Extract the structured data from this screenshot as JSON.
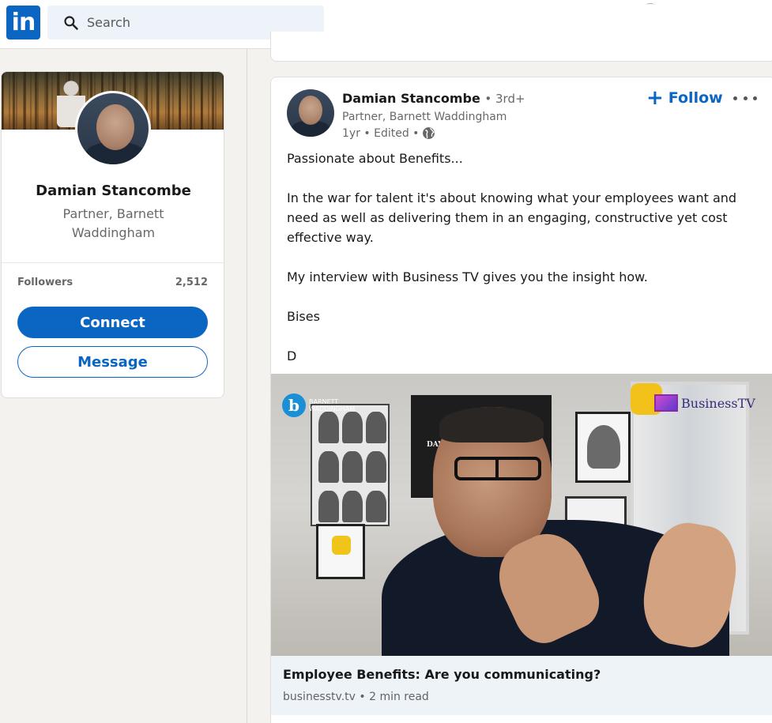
{
  "nav": {
    "logo_text": "in",
    "search_placeholder": "Search"
  },
  "profile_card": {
    "name": "Damian Stancombe",
    "title": "Partner, Barnett Waddingham",
    "followers_label": "Followers",
    "followers_count": "2,512",
    "connect_label": "Connect",
    "message_label": "Message"
  },
  "post": {
    "author": "Damian Stancombe",
    "degree": "• 3rd+",
    "headline": "Partner, Barnett Waddingham",
    "meta": "1yr • Edited •",
    "follow_label": "Follow",
    "body": [
      "Passionate about Benefits...",
      "",
      "In the war for talent it's about knowing what your employees want and need as well as delivering them in an engaging, constructive yet cost effective way.",
      "",
      "My interview with Business TV gives you the insight how.",
      "",
      "Bises",
      "",
      "D"
    ],
    "media": {
      "brand_left": "BARNETT WADDINGHAM",
      "brand_right": "BusinessTV"
    },
    "link": {
      "title": "Employee Benefits: Are you communicating?",
      "meta": "businesstv.tv • 2 min read"
    }
  },
  "colors": {
    "brand_blue": "#0a66c2",
    "page_bg": "#f4f2ee",
    "link_card_bg": "#eef3f8"
  },
  "icons": [
    "linkedin-logo",
    "search-icon",
    "globe-icon",
    "plus-icon",
    "more-horizontal-icon"
  ]
}
